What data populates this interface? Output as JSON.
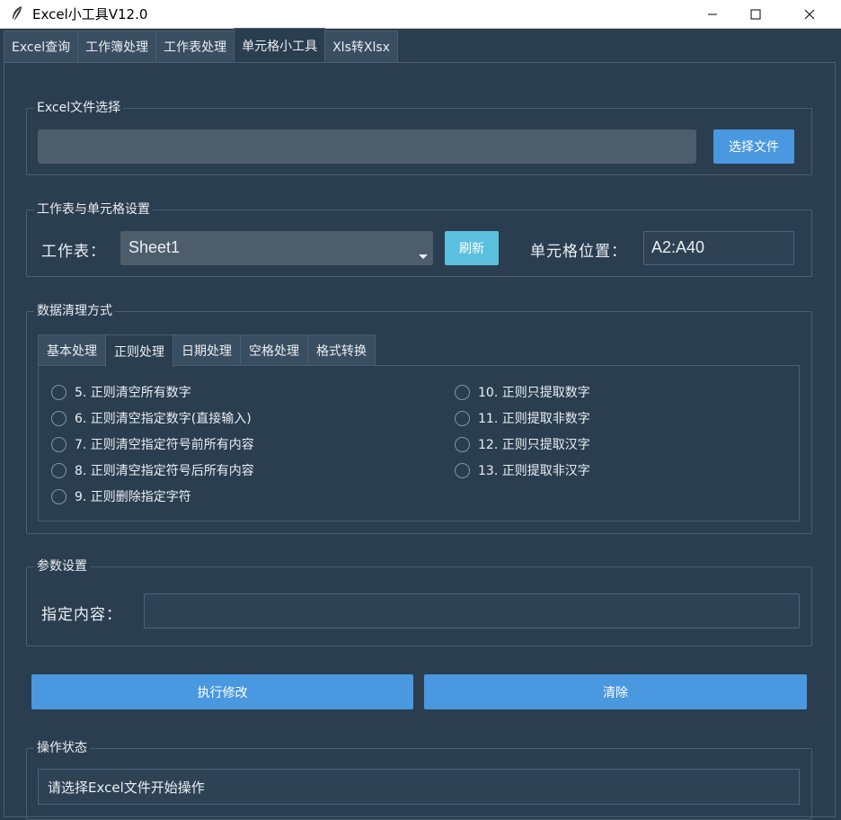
{
  "window": {
    "title": "Excel小工具V12.0",
    "icon": "feather-icon",
    "controls": [
      "minimize-icon",
      "maximize-icon",
      "close-icon"
    ]
  },
  "main_tabs": [
    {
      "label": "Excel查询",
      "active": false
    },
    {
      "label": "工作簿处理",
      "active": false
    },
    {
      "label": "工作表处理",
      "active": false
    },
    {
      "label": "单元格小工具",
      "active": true
    },
    {
      "label": "Xls转Xlsx",
      "active": false
    }
  ],
  "file_section": {
    "title": "Excel文件选择",
    "path_value": "",
    "choose_button": "选择文件"
  },
  "sheet_section": {
    "title": "工作表与单元格设置",
    "sheet_label": "工作表：",
    "sheet_value": "Sheet1",
    "refresh_button": "刷新",
    "cell_label": "单元格位置：",
    "cell_value": "A2:A40"
  },
  "clean_section": {
    "title": "数据清理方式",
    "tabs": [
      {
        "label": "基本处理",
        "active": false
      },
      {
        "label": "正则处理",
        "active": true
      },
      {
        "label": "日期处理",
        "active": false
      },
      {
        "label": "空格处理",
        "active": false
      },
      {
        "label": "格式转换",
        "active": false
      }
    ],
    "options_left": [
      "5. 正则清空所有数字",
      "6. 正则清空指定数字(直接输入)",
      "7. 正则清空指定符号前所有内容",
      "8. 正则清空指定符号后所有内容",
      "9. 正则删除指定字符"
    ],
    "options_right": [
      "10. 正则只提取数字",
      "11. 正则提取非数字",
      "12. 正则只提取汉字",
      "13. 正则提取非汉字"
    ]
  },
  "param_section": {
    "title": "参数设置",
    "content_label": "指定内容：",
    "content_value": ""
  },
  "actions": {
    "execute": "执行修改",
    "clear": "清除"
  },
  "status_section": {
    "title": "操作状态",
    "message": "请选择Excel文件开始操作"
  },
  "colors": {
    "background": "#2b3e50",
    "primary_button": "#4a98e0",
    "info_button": "#5bc0de",
    "entry": "#4e5d6c"
  }
}
